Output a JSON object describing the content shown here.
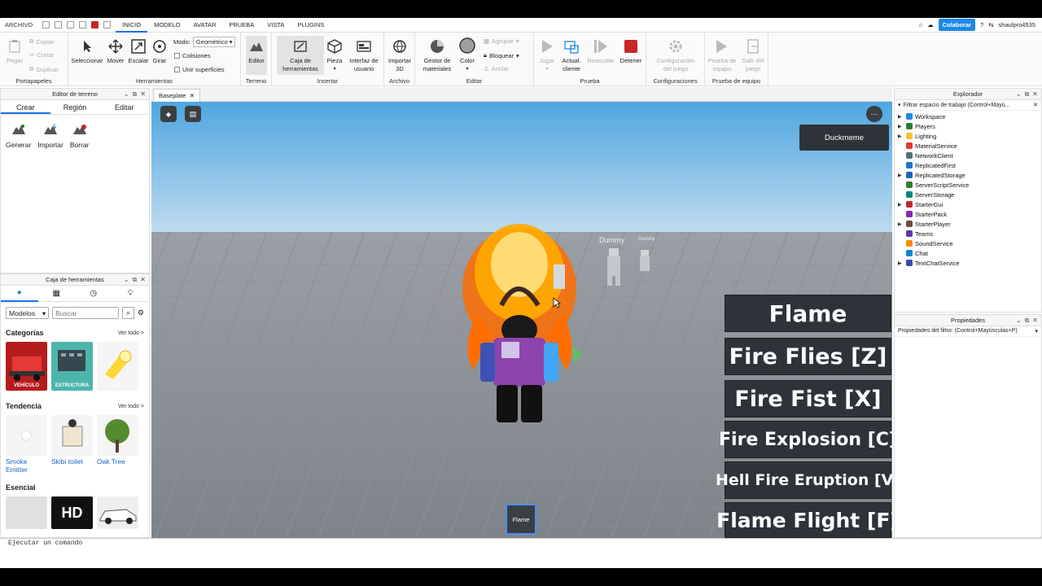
{
  "topbar": {
    "file_label": "ARCHIVO",
    "menu": [
      "INICIO",
      "MODELO",
      "AVATAR",
      "PRUEBA",
      "VISTA",
      "PLUGINS"
    ],
    "collab_label": "Colaborar",
    "username": "shaulpro4535"
  },
  "ribbon": {
    "clipboard": {
      "label": "Portapapeles",
      "paste": "Pegar",
      "copy": "Copiar",
      "cut": "Cortar",
      "duplicate": "Duplicar"
    },
    "tools": {
      "label": "Herramientas",
      "select": "Seleccionar",
      "move": "Mover",
      "scale": "Escalar",
      "rotate": "Girar",
      "mode_label": "Modo:",
      "mode_value": "Geométrico",
      "collisions": "Colisiones",
      "join": "Unir superficies"
    },
    "terrain": {
      "label": "Terreno",
      "editor": "Editor"
    },
    "insert": {
      "label": "Insertar",
      "toolbox_line1": "Caja de",
      "toolbox_line2": "herramientas",
      "part": "Pieza",
      "ui_line1": "Interfaz de",
      "ui_line2": "usuario"
    },
    "file": {
      "label": "Archivo",
      "import_line1": "Importar",
      "import_line2": "3D"
    },
    "edit": {
      "label": "Editar",
      "material_line1": "Gestor de",
      "material_line2": "materiales",
      "color": "Color",
      "group": "Agrupar",
      "lock": "Bloquear",
      "anchor": "Anclar"
    },
    "test": {
      "label": "Prueba",
      "play": "Jugar",
      "update_line1": "Actual.",
      "update_line2": "cliente",
      "resume": "Reanudar",
      "stop": "Detener"
    },
    "settings": {
      "label": "Configuraciones",
      "game_line1": "Configuración",
      "game_line2": "del juego"
    },
    "team_test": {
      "label": "Prueba de equipo",
      "test_line1": "Prueba de",
      "test_line2": "equipo",
      "exit_line1": "Salir del",
      "exit_line2": "juego"
    }
  },
  "terrain_panel": {
    "title": "Editor de terreno",
    "tabs": [
      "Crear",
      "Región",
      "Editar"
    ],
    "tools": [
      "Generar",
      "Importar",
      "Borrar"
    ]
  },
  "toolbox": {
    "title": "Caja de herramientas",
    "dropdown": "Modelos",
    "search_placeholder": "Buscar",
    "see_all": "Ver todo >",
    "categories": {
      "heading": "Categorías",
      "items": [
        "VEHÍCULO",
        "ESTRUCTURA",
        "LUZ"
      ]
    },
    "trending": {
      "heading": "Tendencia",
      "items": [
        "Smoke Emitter",
        "Skibi toilet",
        "Oak Tree"
      ]
    },
    "essential": {
      "heading": "Esencial"
    }
  },
  "viewport": {
    "tab_label": "Baseplate",
    "player_name": "Duckmeme",
    "dummy_labels": [
      "Dummy",
      "Dummy"
    ],
    "abilities": [
      "Flame",
      "Fire Flies [Z]",
      "Fire Fist [X]",
      "Fire Explosion [C]",
      "Hell Fire Eruption [V]",
      "Flame Flight [F]"
    ],
    "hotbar_item": "Flame"
  },
  "explorer": {
    "title": "Explorador",
    "filter": "Filtrar espacio de trabajo (Control+Mayú...",
    "items": [
      "Workspace",
      "Players",
      "Lighting",
      "MaterialService",
      "NetworkClient",
      "ReplicatedFirst",
      "ReplicatedStorage",
      "ServerScriptService",
      "ServerStorage",
      "StarterGui",
      "StarterPack",
      "StarterPlayer",
      "Teams",
      "SoundService",
      "Chat",
      "TextChatService"
    ]
  },
  "properties": {
    "title": "Propiedades",
    "filter": "Propiedades del filtro: (Control+Mayúsculas+P)"
  },
  "command_bar": {
    "text": "Ejecutar un comando"
  }
}
